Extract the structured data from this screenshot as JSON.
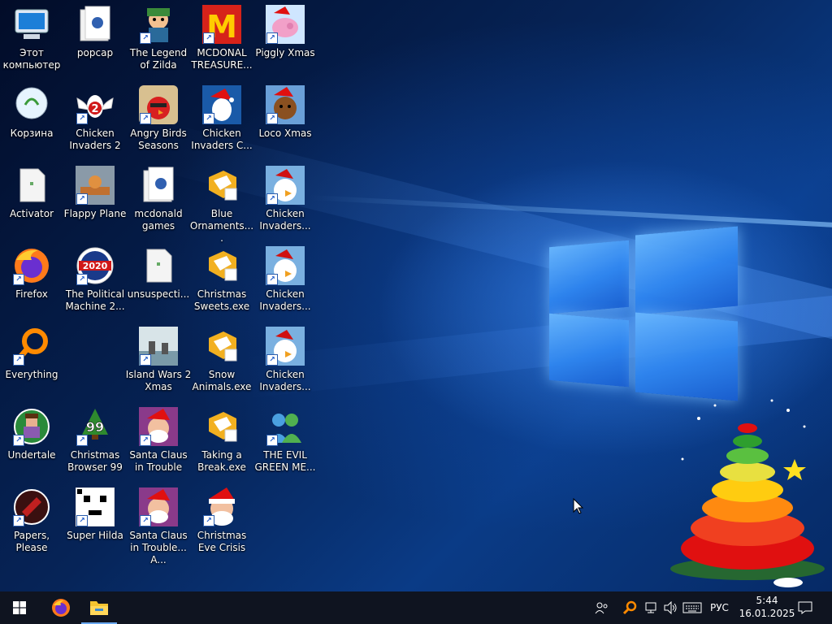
{
  "desktop": {
    "icons": [
      {
        "label": "Этот компьютер",
        "icon": "computer-icon",
        "shortcut": false
      },
      {
        "label": "popcap",
        "icon": "folder-icon",
        "shortcut": false
      },
      {
        "label": "The Legend of Zilda",
        "icon": "zilda-game-icon",
        "shortcut": true
      },
      {
        "label": "MCDONAL TREASURE...",
        "icon": "mcdonalds-icon",
        "shortcut": true
      },
      {
        "label": "Piggly Xmas",
        "icon": "piggly-xmas-icon",
        "shortcut": true
      },
      {
        "label": "Корзина",
        "icon": "recycle-bin-icon",
        "shortcut": false
      },
      {
        "label": "Chicken Invaders 2",
        "icon": "chicken-invaders-2-icon",
        "shortcut": true
      },
      {
        "label": "Angry Birds Seasons",
        "icon": "angry-birds-icon",
        "shortcut": true
      },
      {
        "label": "Chicken Invaders C...",
        "icon": "chicken-invaders-christmas-icon",
        "shortcut": true
      },
      {
        "label": "Loco Xmas",
        "icon": "loco-xmas-icon",
        "shortcut": true
      },
      {
        "label": "Activator",
        "icon": "file-icon",
        "shortcut": false
      },
      {
        "label": "Flappy Plane",
        "icon": "flappy-plane-icon",
        "shortcut": true
      },
      {
        "label": "mcdonald games",
        "icon": "folder-icon",
        "shortcut": false
      },
      {
        "label": "Blue Ornaments....",
        "icon": "exe-puzzle-icon",
        "shortcut": false
      },
      {
        "label": "Chicken Invaders...",
        "icon": "chicken-invaders-icon",
        "shortcut": true
      },
      {
        "label": "Firefox",
        "icon": "firefox-icon",
        "shortcut": true
      },
      {
        "label": "The Political Machine 2...",
        "icon": "political-machine-icon",
        "shortcut": true
      },
      {
        "label": "unsuspecti...",
        "icon": "file-icon",
        "shortcut": false
      },
      {
        "label": "Christmas Sweets.exe",
        "icon": "exe-puzzle-icon",
        "shortcut": false
      },
      {
        "label": "Chicken Invaders...",
        "icon": "chicken-invaders-icon",
        "shortcut": true
      },
      {
        "label": "Everything",
        "icon": "everything-search-icon",
        "shortcut": true
      },
      {
        "label": "Island Wars 2 Xmas",
        "icon": "island-wars-icon",
        "shortcut": true
      },
      {
        "label": "Snow Animals.exe",
        "icon": "exe-puzzle-icon",
        "shortcut": false
      },
      {
        "label": "Chicken Invaders...",
        "icon": "chicken-invaders-icon",
        "shortcut": true
      },
      {
        "label": "Undertale",
        "icon": "undertale-icon",
        "shortcut": true
      },
      {
        "label": "Christmas Browser 99",
        "icon": "christmas-browser-icon",
        "shortcut": true
      },
      {
        "label": "Santa Claus in Trouble",
        "icon": "santa-trouble-icon",
        "shortcut": true
      },
      {
        "label": "Taking a Break.exe",
        "icon": "exe-puzzle-icon",
        "shortcut": false
      },
      {
        "label": "THE EVIL GREEN ME...",
        "icon": "messenger-icon",
        "shortcut": true
      },
      {
        "label": "Papers, Please",
        "icon": "papers-please-icon",
        "shortcut": true
      },
      {
        "label": "Super Hilda",
        "icon": "super-hilda-icon",
        "shortcut": true
      },
      {
        "label": "Santa Claus in Trouble... A...",
        "icon": "santa-trouble-icon",
        "shortcut": true
      },
      {
        "label": "Christmas Eve Crisis",
        "icon": "santa-icon",
        "shortcut": true
      }
    ],
    "badges": {
      "ci2": "2",
      "politics": "2020",
      "browser": "99",
      "mcd": "M"
    }
  },
  "taskbar": {
    "start_icon": "windows-start-icon",
    "pinned": [
      {
        "name": "Firefox",
        "icon": "firefox-icon"
      },
      {
        "name": "File Explorer",
        "icon": "folder-icon"
      }
    ],
    "tray": {
      "language": "РУС",
      "time": "5:44",
      "date": "16.01.2025"
    }
  },
  "colors": {
    "accent": "#2f86f0",
    "taskbar": "#0f1420"
  }
}
